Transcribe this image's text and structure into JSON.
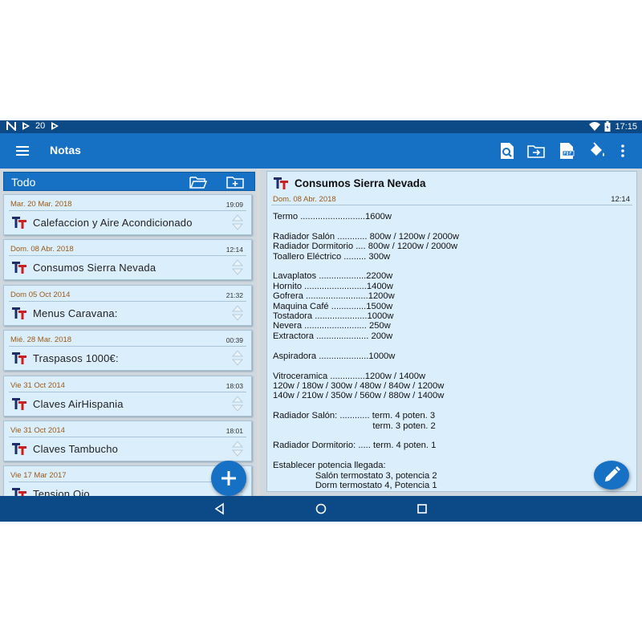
{
  "status_bar": {
    "notification_text": "20",
    "clock": "17:15",
    "icons": [
      "n-notification-icon",
      "play-icon",
      "play-icon",
      "wifi-icon",
      "battery-icon"
    ]
  },
  "toolbar": {
    "title": "Notas",
    "actions": [
      "search-document-icon",
      "folder-move-icon",
      "pdf-export-icon",
      "paint-bucket-icon",
      "more-vert-icon"
    ]
  },
  "folder": {
    "name": "Todo"
  },
  "notes": [
    {
      "date": "Mar. 20 Mar. 2018",
      "time": "19:09",
      "title": "Calefaccion y Aire Acondicionado"
    },
    {
      "date": "Dom. 08 Abr. 2018",
      "time": "12:14",
      "title": "Consumos Sierra Nevada"
    },
    {
      "date": "Dom 05 Oct 2014",
      "time": "21:32",
      "title": "Menus Caravana:"
    },
    {
      "date": "Mié. 28 Mar. 2018",
      "time": "00:39",
      "title": "Traspasos 1000€:"
    },
    {
      "date": "Vie 31 Oct 2014",
      "time": "18:03",
      "title": "Claves AirHispania"
    },
    {
      "date": "Vie 31 Oct 2014",
      "time": "18:01",
      "title": "Claves Tambucho"
    },
    {
      "date": "Vie 17 Mar 2017",
      "time": "",
      "title": "Tension Ojo"
    }
  ],
  "detail": {
    "title": "Consumos Sierra Nevada",
    "date": "Dom. 08 Abr. 2018",
    "time": "12:14",
    "body": "Termo ..........................1600w\n\nRadiador Salón ............ 800w / 1200w / 2000w\nRadiador Dormitorio .... 800w / 1200w / 2000w\nToallero Eléctrico ......... 300w\n\nLavaplatos ...................2200w\nHornito .........................1400w\nGofrera .........................1200w\nMaquina Café ..............1500w\nTostadora .....................1000w\nNevera ......................... 250w\nExtractora ..................... 200w\n\nAspiradora ....................1000w\n\nVitroceramica ..............1200w / 1400w\n120w / 180w / 300w / 480w / 840w / 1200w\n140w / 210w / 350w / 560w / 880w / 1400w\n\nRadiador Salón: ............ term. 4 poten. 3\n                                        term. 3 poten. 2\n\nRadiador Dormitorio: ..... term. 4 poten. 1\n\nEstablecer potencia llegada:\n                 Salón termostato 3, potencia 2\n                 Dorm termostato 4, Potencia 1"
  },
  "colors": {
    "primary": "#1670c4",
    "primary_dark": "#0b4a86",
    "card_bg": "#dbeefb",
    "date_color": "#9a5a15"
  }
}
